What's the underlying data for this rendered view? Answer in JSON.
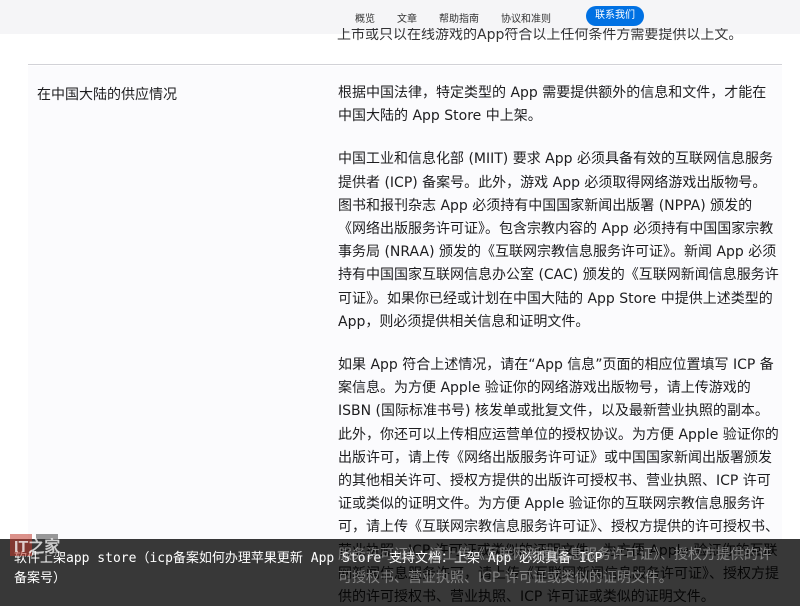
{
  "nav": {
    "items": [
      "概览",
      "文章",
      "帮助指南",
      "协议和准则"
    ],
    "contact": "联系我们"
  },
  "cut_top_text": "上市或只以在线游戏的App符合以上任何条件方需要提供以上文。",
  "section": {
    "title": "在中国大陆的供应情况",
    "paragraphs": [
      "根据中国法律，特定类型的 App 需要提供额外的信息和文件，才能在中国大陆的 App Store 中上架。",
      "中国工业和信息化部 (MIIT) 要求 App 必须具备有效的互联网信息服务提供者 (ICP) 备案号。此外，游戏 App 必须取得网络游戏出版物号。图书和报刊杂志 App 必须持有中国国家新闻出版署 (NPPA) 颁发的《网络出版服务许可证》。包含宗教内容的 App 必须持有中国国家宗教事务局 (NRAA) 颁发的《互联网宗教信息服务许可证》。新闻 App 必须持有中国国家互联网信息办公室 (CAC) 颁发的《互联网新闻信息服务许可证》。如果你已经或计划在中国大陆的 App Store 中提供上述类型的 App，则必须提供相关信息和证明文件。",
      "如果 App 符合上述情况，请在“App 信息”页面的相应位置填写 ICP 备案信息。为方便 Apple 验证你的网络游戏出版物号，请上传游戏的 ISBN (国际标准书号) 核发单或批复文件，以及最新营业执照的副本。此外，你还可以上传相应运营单位的授权协议。为方便 Apple 验证你的出版许可，请上传《网络出版服务许可证》或中国国家新闻出版署颁发的其他相关许可、授权方提供的出版许可授权书、营业执照、ICP 许可证或类似的证明文件。为方便 Apple 验证你的互联网宗教信息服务许可，请上传《互联网宗教信息服务许可证》、授权方提供的许可授权书、营业执照、ICP 许可证或类似的证明文件。为方便 Apple 验证你的互联网新闻信息服务许可，请上传《互联网新闻信息服务许可证》、授权方提供的许可授权书、营业执照、ICP 许可证或类似的证明文件。"
    ]
  },
  "overlay": {
    "caption": "软件上架app store（icp备案如何办理苹果更新 App Store 支持文档：上架 App 必须具备 ICP 备案号）",
    "logo_text": "IT之家",
    "under_caption": "服务许可证》、请上传《互联网新闻信息服务许可证》、授权方提供的许可授权书、营业执照、ICP 许可证或类似的证明文件。"
  }
}
